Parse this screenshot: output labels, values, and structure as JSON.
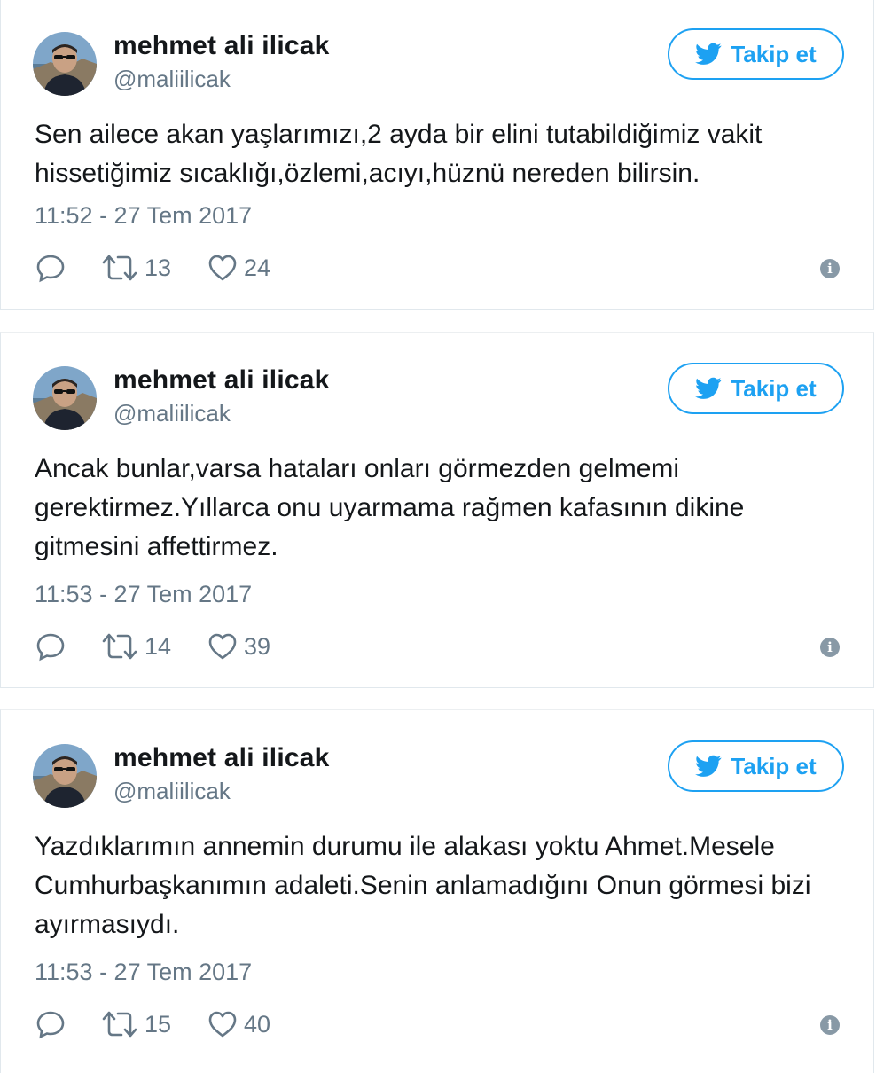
{
  "tweets": [
    {
      "author_name": "mehmet ali ilicak",
      "handle": "@maliilicak",
      "follow_label": "Takip et",
      "text": "Sen ailece akan yaşlarımızı,2 ayda bir elini tutabildiğimiz vakit hissetiğimiz sıcaklığı,özlemi,acıyı,hüznü nereden bilirsin.",
      "timestamp": "11:52 - 27 Tem 2017",
      "retweets": "13",
      "likes": "24"
    },
    {
      "author_name": "mehmet ali ilicak",
      "handle": "@maliilicak",
      "follow_label": "Takip et",
      "text": "Ancak bunlar,varsa hataları onları görmezden gelmemi gerektirmez.Yıllarca onu uyarmama rağmen kafasının dikine gitmesini affettirmez.",
      "timestamp": "11:53 - 27 Tem 2017",
      "retweets": "14",
      "likes": "39"
    },
    {
      "author_name": "mehmet ali ilicak",
      "handle": "@maliilicak",
      "follow_label": "Takip et",
      "text": "Yazdıklarımın annemin durumu ile alakası yoktu Ahmet.Mesele Cumhurbaşkanımın adaleti.Senin anlamadığını Onun görmesi bizi ayırmasıydı.",
      "timestamp": "11:53 - 27 Tem 2017",
      "retweets": "15",
      "likes": "40"
    }
  ],
  "icons": {
    "reply": "reply-icon",
    "retweet": "retweet-icon",
    "like": "heart-icon",
    "info": "info-icon",
    "follow": "twitter-bird-icon"
  },
  "colors": {
    "accent": "#1da1f2",
    "text": "#14171a",
    "muted": "#657786"
  }
}
